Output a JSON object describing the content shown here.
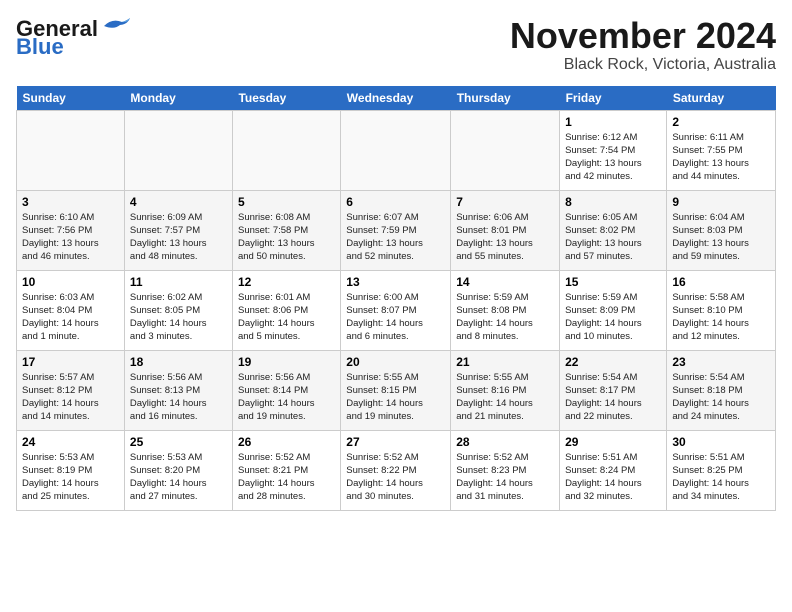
{
  "header": {
    "logo_line1": "General",
    "logo_line2": "Blue",
    "title": "November 2024",
    "subtitle": "Black Rock, Victoria, Australia"
  },
  "days_of_week": [
    "Sunday",
    "Monday",
    "Tuesday",
    "Wednesday",
    "Thursday",
    "Friday",
    "Saturday"
  ],
  "weeks": [
    {
      "cells": [
        {
          "day": "",
          "info": ""
        },
        {
          "day": "",
          "info": ""
        },
        {
          "day": "",
          "info": ""
        },
        {
          "day": "",
          "info": ""
        },
        {
          "day": "",
          "info": ""
        },
        {
          "day": "1",
          "info": "Sunrise: 6:12 AM\nSunset: 7:54 PM\nDaylight: 13 hours\nand 42 minutes."
        },
        {
          "day": "2",
          "info": "Sunrise: 6:11 AM\nSunset: 7:55 PM\nDaylight: 13 hours\nand 44 minutes."
        }
      ]
    },
    {
      "cells": [
        {
          "day": "3",
          "info": "Sunrise: 6:10 AM\nSunset: 7:56 PM\nDaylight: 13 hours\nand 46 minutes."
        },
        {
          "day": "4",
          "info": "Sunrise: 6:09 AM\nSunset: 7:57 PM\nDaylight: 13 hours\nand 48 minutes."
        },
        {
          "day": "5",
          "info": "Sunrise: 6:08 AM\nSunset: 7:58 PM\nDaylight: 13 hours\nand 50 minutes."
        },
        {
          "day": "6",
          "info": "Sunrise: 6:07 AM\nSunset: 7:59 PM\nDaylight: 13 hours\nand 52 minutes."
        },
        {
          "day": "7",
          "info": "Sunrise: 6:06 AM\nSunset: 8:01 PM\nDaylight: 13 hours\nand 55 minutes."
        },
        {
          "day": "8",
          "info": "Sunrise: 6:05 AM\nSunset: 8:02 PM\nDaylight: 13 hours\nand 57 minutes."
        },
        {
          "day": "9",
          "info": "Sunrise: 6:04 AM\nSunset: 8:03 PM\nDaylight: 13 hours\nand 59 minutes."
        }
      ]
    },
    {
      "cells": [
        {
          "day": "10",
          "info": "Sunrise: 6:03 AM\nSunset: 8:04 PM\nDaylight: 14 hours\nand 1 minute."
        },
        {
          "day": "11",
          "info": "Sunrise: 6:02 AM\nSunset: 8:05 PM\nDaylight: 14 hours\nand 3 minutes."
        },
        {
          "day": "12",
          "info": "Sunrise: 6:01 AM\nSunset: 8:06 PM\nDaylight: 14 hours\nand 5 minutes."
        },
        {
          "day": "13",
          "info": "Sunrise: 6:00 AM\nSunset: 8:07 PM\nDaylight: 14 hours\nand 6 minutes."
        },
        {
          "day": "14",
          "info": "Sunrise: 5:59 AM\nSunset: 8:08 PM\nDaylight: 14 hours\nand 8 minutes."
        },
        {
          "day": "15",
          "info": "Sunrise: 5:59 AM\nSunset: 8:09 PM\nDaylight: 14 hours\nand 10 minutes."
        },
        {
          "day": "16",
          "info": "Sunrise: 5:58 AM\nSunset: 8:10 PM\nDaylight: 14 hours\nand 12 minutes."
        }
      ]
    },
    {
      "cells": [
        {
          "day": "17",
          "info": "Sunrise: 5:57 AM\nSunset: 8:12 PM\nDaylight: 14 hours\nand 14 minutes."
        },
        {
          "day": "18",
          "info": "Sunrise: 5:56 AM\nSunset: 8:13 PM\nDaylight: 14 hours\nand 16 minutes."
        },
        {
          "day": "19",
          "info": "Sunrise: 5:56 AM\nSunset: 8:14 PM\nDaylight: 14 hours\nand 19 minutes."
        },
        {
          "day": "20",
          "info": "Sunrise: 5:55 AM\nSunset: 8:15 PM\nDaylight: 14 hours\nand 19 minutes."
        },
        {
          "day": "21",
          "info": "Sunrise: 5:55 AM\nSunset: 8:16 PM\nDaylight: 14 hours\nand 21 minutes."
        },
        {
          "day": "22",
          "info": "Sunrise: 5:54 AM\nSunset: 8:17 PM\nDaylight: 14 hours\nand 22 minutes."
        },
        {
          "day": "23",
          "info": "Sunrise: 5:54 AM\nSunset: 8:18 PM\nDaylight: 14 hours\nand 24 minutes."
        }
      ]
    },
    {
      "cells": [
        {
          "day": "24",
          "info": "Sunrise: 5:53 AM\nSunset: 8:19 PM\nDaylight: 14 hours\nand 25 minutes."
        },
        {
          "day": "25",
          "info": "Sunrise: 5:53 AM\nSunset: 8:20 PM\nDaylight: 14 hours\nand 27 minutes."
        },
        {
          "day": "26",
          "info": "Sunrise: 5:52 AM\nSunset: 8:21 PM\nDaylight: 14 hours\nand 28 minutes."
        },
        {
          "day": "27",
          "info": "Sunrise: 5:52 AM\nSunset: 8:22 PM\nDaylight: 14 hours\nand 30 minutes."
        },
        {
          "day": "28",
          "info": "Sunrise: 5:52 AM\nSunset: 8:23 PM\nDaylight: 14 hours\nand 31 minutes."
        },
        {
          "day": "29",
          "info": "Sunrise: 5:51 AM\nSunset: 8:24 PM\nDaylight: 14 hours\nand 32 minutes."
        },
        {
          "day": "30",
          "info": "Sunrise: 5:51 AM\nSunset: 8:25 PM\nDaylight: 14 hours\nand 34 minutes."
        }
      ]
    }
  ]
}
